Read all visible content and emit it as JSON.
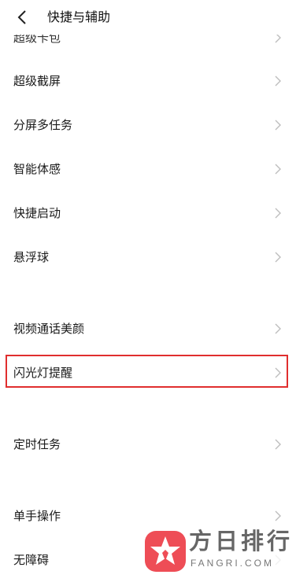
{
  "header": {
    "title": "快捷与辅助",
    "back_icon": "chevron-left-icon"
  },
  "list": {
    "partial_item": {
      "label": "超级卡包"
    },
    "items": [
      {
        "label": "超级截屏"
      },
      {
        "label": "分屏多任务"
      },
      {
        "label": "智能体感"
      },
      {
        "label": "快捷启动"
      },
      {
        "label": "悬浮球"
      },
      {
        "label": "视频通话美颜"
      },
      {
        "label": "闪光灯提醒",
        "highlighted": true
      },
      {
        "label": "定时任务"
      },
      {
        "label": "单手操作"
      },
      {
        "label": "无障碍"
      }
    ]
  },
  "watermark": {
    "name": "方日排行",
    "url": "FANGRI.COM",
    "logo_color": "#ee4d56"
  },
  "colors": {
    "highlight_border": "#e02e2e",
    "chevron": "#bdbdbd"
  }
}
